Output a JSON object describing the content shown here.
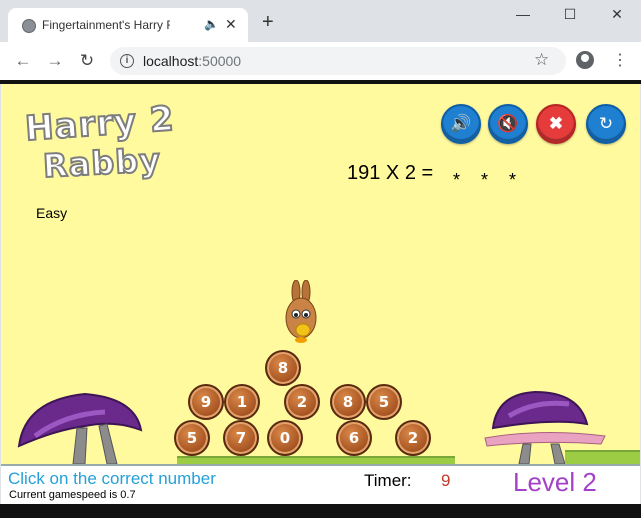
{
  "browser": {
    "tab_title": "Fingertainment's Harry Rabb",
    "tab_audio_icon": "speaker-icon",
    "tab_close": "✕",
    "new_tab": "+",
    "window_minimize": "—",
    "window_maximize": "☐",
    "window_close": "✕",
    "back": "←",
    "forward": "→",
    "reload": "↻",
    "url_host": "localhost",
    "url_port": ":50000",
    "bookmark": "☆",
    "menu": "⋮"
  },
  "game": {
    "logo_line1": "Harry 2",
    "logo_line2": "Rabby",
    "difficulty": "Easy",
    "question": "191 X 2 =",
    "answer_placeholder": "* * *",
    "controls": {
      "sound_on": "🔊",
      "mute": "🔇",
      "close": "✖",
      "restart": "↻"
    },
    "coins_row1": [
      "8"
    ],
    "coins_row2": [
      "9",
      "1",
      "2",
      "8",
      "5"
    ],
    "coins_row3": [
      "5",
      "7",
      "0",
      "6",
      "2"
    ]
  },
  "footer": {
    "instruction": "Click on the correct number",
    "gamespeed": "Current gamespeed is 0.7",
    "timer_label": "Timer:",
    "timer_value": "9",
    "level": "Level 2"
  },
  "colors": {
    "game_bg": "#fffa9d",
    "instruction": "#26a0d8",
    "level": "#a541c9",
    "timer_value": "#c0392b"
  }
}
